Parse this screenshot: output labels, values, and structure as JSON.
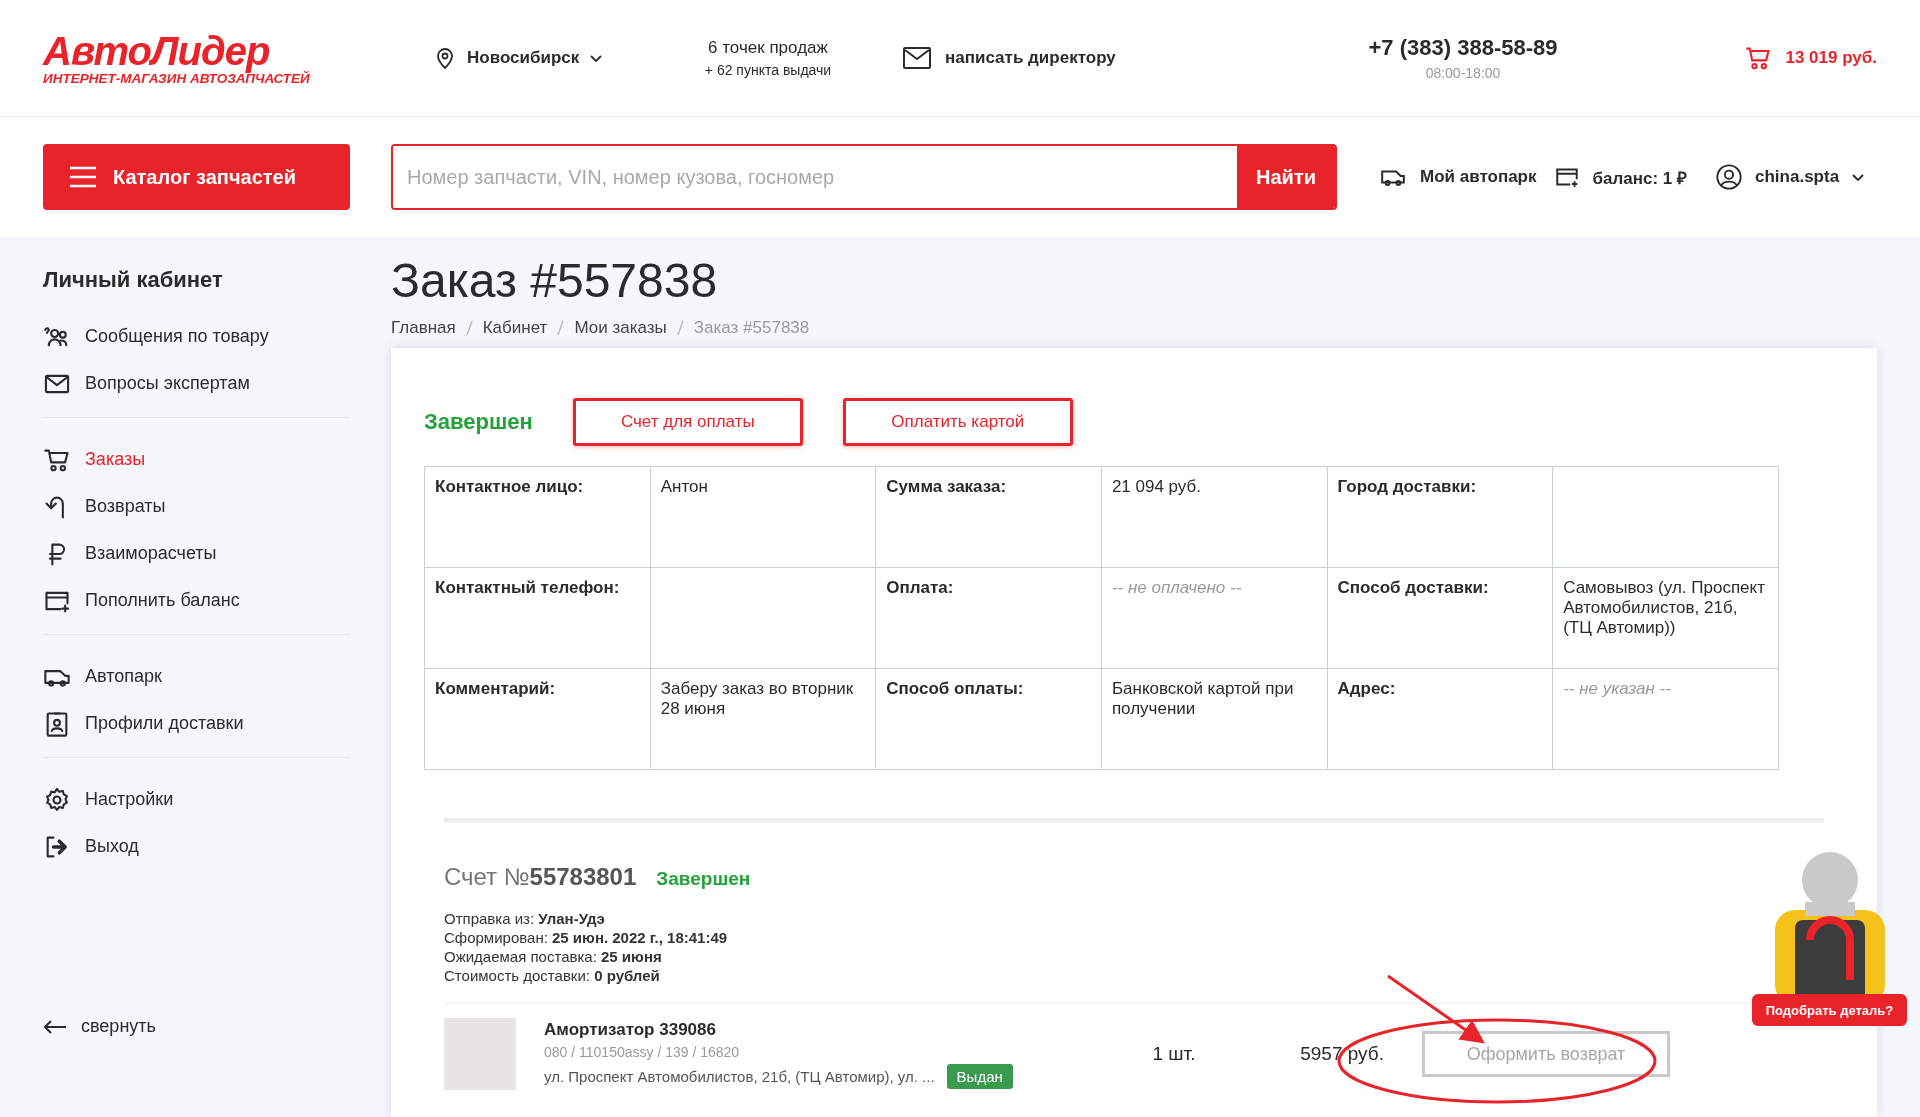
{
  "logo": {
    "name": "АвтоЛидер",
    "tagline": "ИНТЕРНЕТ-МАГАЗИН АВТОЗАПЧАСТЕЙ"
  },
  "header": {
    "city": "Новосибирск",
    "points": "6 точек продаж",
    "pickup": "+ 62 пункта выдачи",
    "write_director": "написать директору",
    "phone": "+7 (383) 388-58-89",
    "hours": "08:00-18:00",
    "cart_total": "13 019 руб."
  },
  "nav": {
    "catalog": "Каталог запчастей",
    "search": {
      "placeholder": "Номер запчасти, VIN, номер кузова, госномер"
    },
    "search_button": "Найти",
    "garage": "Мой автопарк",
    "balance": "баланс: 1 ₽",
    "user": "china.spta"
  },
  "sidebar": {
    "title": "Личный кабинет",
    "groups": [
      [
        {
          "label": "Сообщения по товару",
          "selected": false
        },
        {
          "label": "Вопросы экспертам",
          "selected": false
        }
      ],
      [
        {
          "label": "Заказы",
          "selected": true
        },
        {
          "label": "Возвраты",
          "selected": false
        },
        {
          "label": "Взаиморасчеты",
          "selected": false
        },
        {
          "label": "Пополнить баланс",
          "selected": false
        }
      ],
      [
        {
          "label": "Автопарк",
          "selected": false
        },
        {
          "label": "Профили доставки",
          "selected": false
        }
      ],
      [
        {
          "label": "Настройки",
          "selected": false
        },
        {
          "label": "Выход",
          "selected": false
        }
      ]
    ],
    "collapse": "свернуть"
  },
  "page": {
    "title": "Заказ #557838",
    "breadcrumbs": [
      "Главная",
      "Кабинет",
      "Мои заказы",
      "Заказ #557838"
    ]
  },
  "order": {
    "status": "Завершен",
    "buttons": [
      "Счет для оплаты",
      "Оплатить картой"
    ],
    "rows": [
      [
        {
          "label": "Контактное лицо:",
          "value": "Антон",
          "empty": false
        },
        {
          "label": "Сумма заказа:",
          "value": "21 094 руб.",
          "empty": false
        },
        {
          "label": "Город доставки:"
        }
      ],
      [
        {
          "label": "Контактный телефон:"
        },
        {
          "label": "Оплата:",
          "value": "-- не оплачено --",
          "empty": true
        },
        {
          "label": "Способ доставки:",
          "value": "Самовывоз (ул. Проспект Автомобилистов, 21б, (ТЦ Автомир))",
          "empty": false
        }
      ],
      [
        {
          "label": "Комментарий:",
          "value": "Заберу заказ во вторник 28 июня",
          "empty": false
        },
        {
          "label": "Способ оплаты:",
          "value": "Банковской картой при получении",
          "empty": false
        },
        {
          "label": "Адрес:",
          "value": "-- не указан --",
          "empty": true
        }
      ]
    ]
  },
  "invoice": {
    "prefix": "Счет №",
    "number": "55783801",
    "status": "Завершен",
    "details": [
      "Отправка из: **Улан-Удэ**",
      "Сформирован: **25 июн. 2022 г., 18:41:49**",
      "Ожидаемая поставка: **25 июня**",
      "Стоимость доставки: **0 рублей**"
    ],
    "item": {
      "name": "Амортизатор 339086",
      "codes": "080 / 110150assy / 139 / 16820",
      "address": "ул. Проспект Автомобилистов, 21б, (ТЦ Автомир), ул. ...",
      "badge": "Выдан",
      "qty": "1 шт.",
      "price": "5957 руб.",
      "return_button": "Оформить возврат",
      "return_disabled": true
    }
  },
  "helper": {
    "label": "Подобрать деталь?"
  }
}
